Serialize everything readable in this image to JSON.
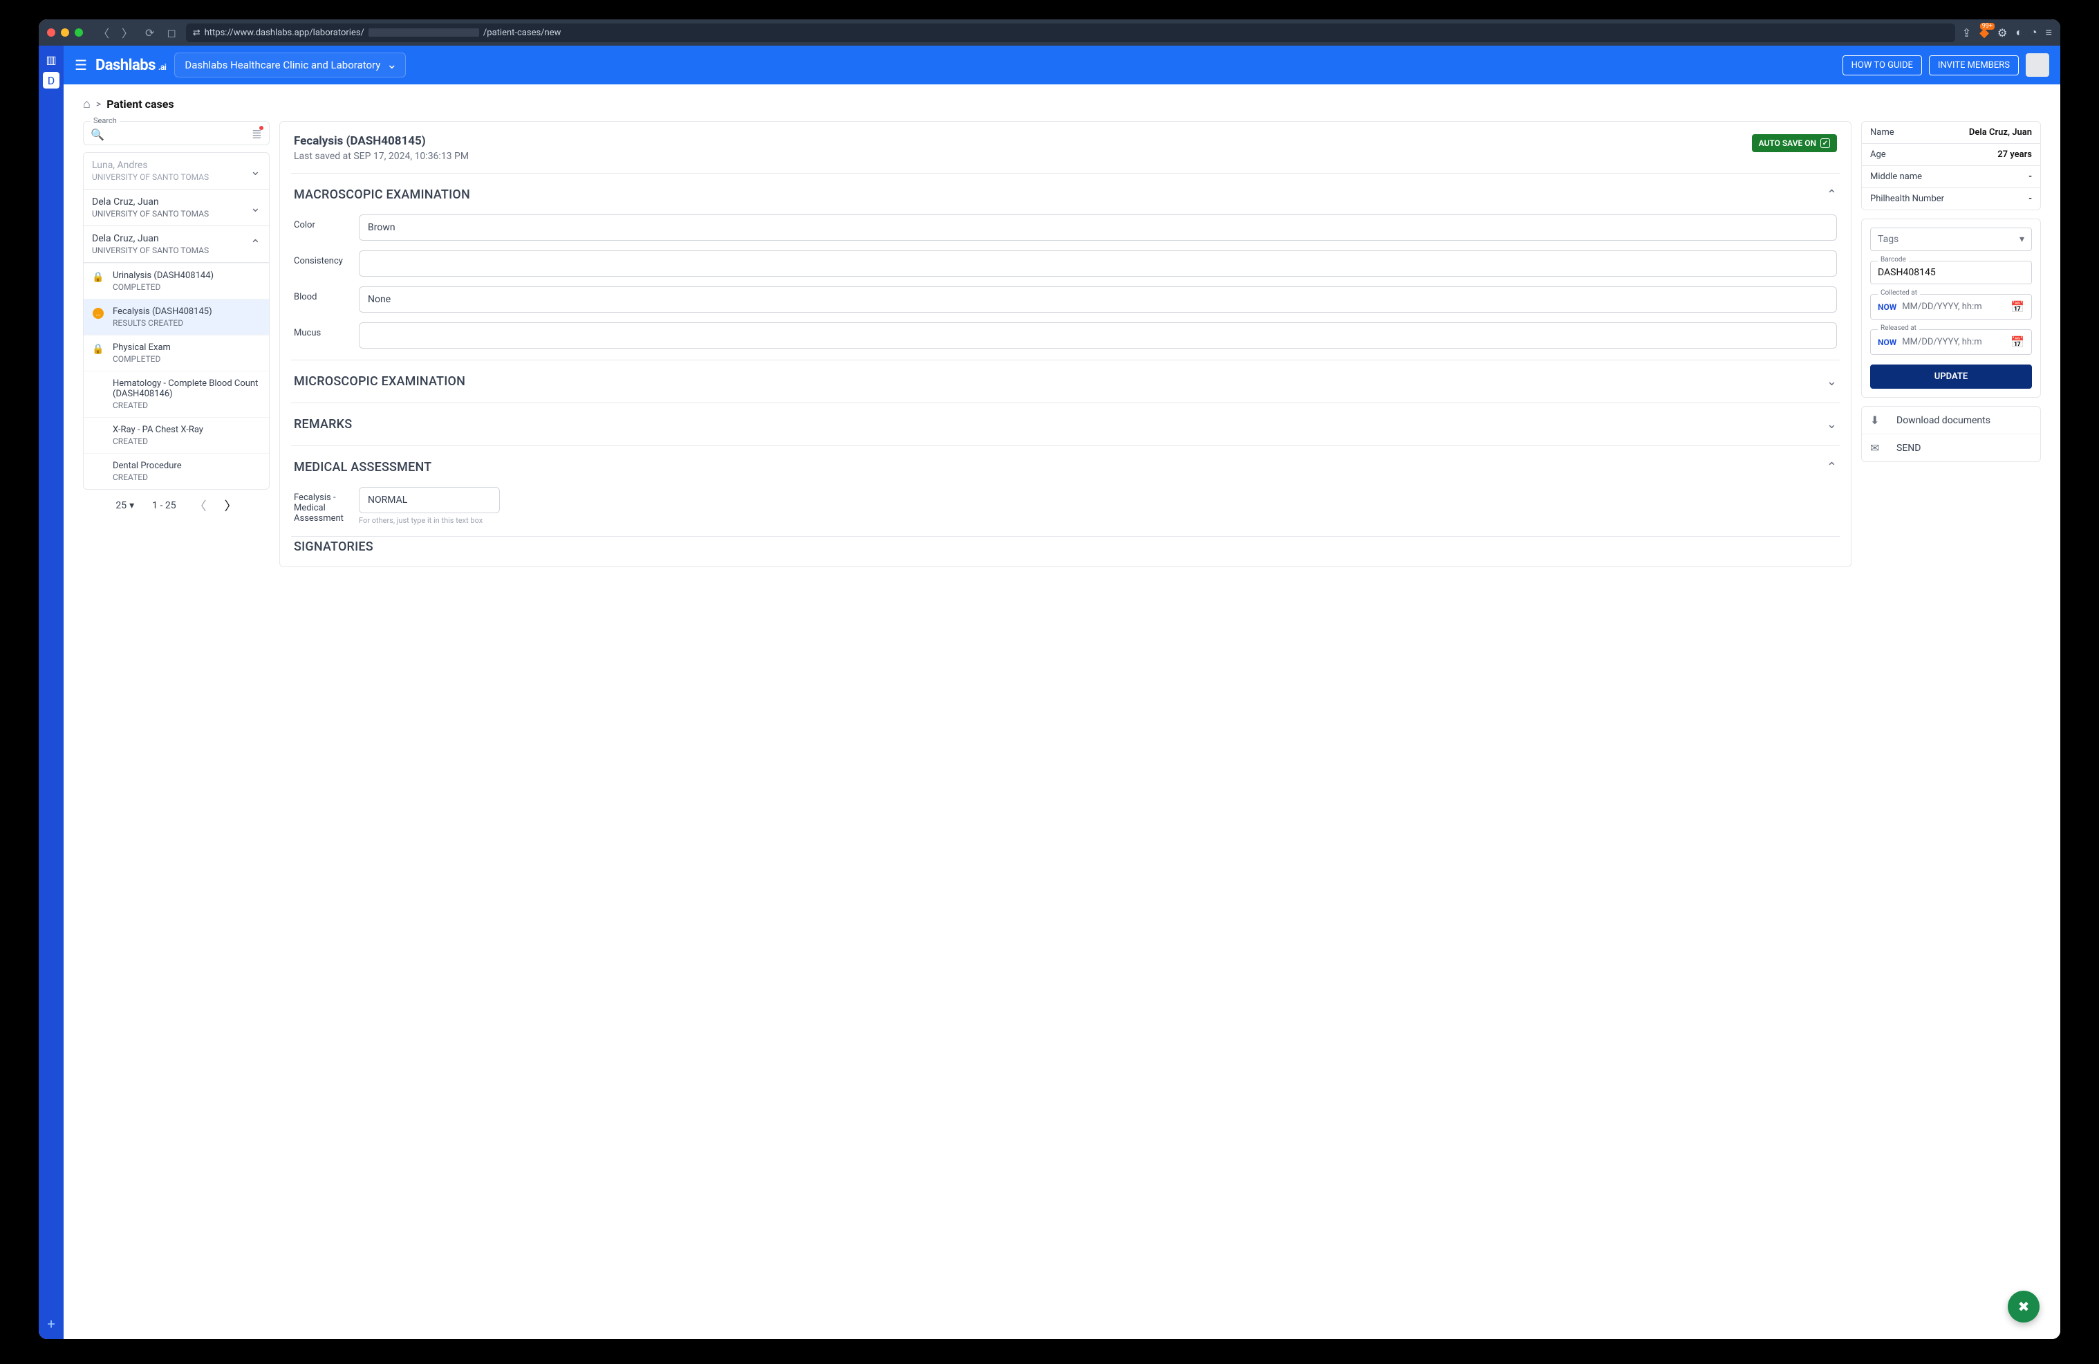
{
  "browser": {
    "url_prefix": "https://www.dashlabs.app/laboratories/",
    "url_suffix": "/patient-cases/new",
    "brave_badge": "99+"
  },
  "header": {
    "brand": "Dashlabs",
    "brand_suffix": ".ai",
    "org": "Dashlabs Healthcare Clinic and Laboratory",
    "how_to": "HOW TO GUIDE",
    "invite": "INVITE MEMBERS"
  },
  "breadcrumb": {
    "current": "Patient cases"
  },
  "search": {
    "label": "Search"
  },
  "cases": [
    {
      "name": "Luna, Andres",
      "org": "UNIVERSITY OF SANTO TOMAS",
      "muted": true,
      "expanded": false
    },
    {
      "name": "Dela Cruz, Juan",
      "org": "UNIVERSITY OF SANTO TOMAS",
      "muted": false,
      "expanded": false
    },
    {
      "name": "Dela Cruz, Juan",
      "org": "UNIVERSITY OF SANTO TOMAS",
      "muted": false,
      "expanded": true,
      "tests": [
        {
          "icon": "lock",
          "name": "Urinalysis (DASH408144)",
          "status": "COMPLETED",
          "selected": false
        },
        {
          "icon": "dots",
          "name": "Fecalysis (DASH408145)",
          "status": "RESULTS CREATED",
          "selected": true
        },
        {
          "icon": "lock",
          "name": "Physical Exam",
          "status": "COMPLETED",
          "selected": false
        },
        {
          "icon": "",
          "name": "Hematology - Complete Blood Count (DASH408146)",
          "status": "CREATED",
          "selected": false
        },
        {
          "icon": "",
          "name": "X-Ray - PA Chest X-Ray",
          "status": "CREATED",
          "selected": false
        },
        {
          "icon": "",
          "name": "Dental Procedure",
          "status": "CREATED",
          "selected": false
        }
      ]
    }
  ],
  "pager": {
    "size": "25",
    "range": "1 - 25"
  },
  "middle": {
    "title": "Fecalysis (DASH408145)",
    "last_saved": "Last saved at SEP 17, 2024, 10:36:13 PM",
    "autosave": "AUTO SAVE ON",
    "sections": {
      "macro": {
        "title": "MACROSCOPIC EXAMINATION",
        "open": true,
        "fields": {
          "color": {
            "label": "Color",
            "value": "Brown"
          },
          "consistency": {
            "label": "Consistency",
            "value": ""
          },
          "blood": {
            "label": "Blood",
            "value": "None"
          },
          "mucus": {
            "label": "Mucus",
            "value": ""
          }
        }
      },
      "micro": {
        "title": "MICROSCOPIC EXAMINATION",
        "open": false
      },
      "remarks": {
        "title": "REMARKS",
        "open": false
      },
      "assess": {
        "title": "MEDICAL ASSESSMENT",
        "open": true,
        "field_label": "Fecalysis - Medical Assessment",
        "field_value": "NORMAL",
        "help": "For others, just type it in this text box"
      },
      "sign": {
        "title": "SIGNATORIES",
        "open": false
      }
    }
  },
  "right": {
    "info": [
      {
        "k": "Name",
        "v": "Dela Cruz, Juan"
      },
      {
        "k": "Age",
        "v": "27 years"
      },
      {
        "k": "Middle name",
        "v": "-"
      },
      {
        "k": "Philhealth Number",
        "v": "-"
      }
    ],
    "tags": "Tags",
    "barcode": {
      "label": "Barcode",
      "value": "DASH408145"
    },
    "collected": {
      "label": "Collected at",
      "now": "NOW",
      "placeholder": "MM/DD/YYYY, hh:m"
    },
    "released": {
      "label": "Released at",
      "now": "NOW",
      "placeholder": "MM/DD/YYYY, hh:m"
    },
    "update": "UPDATE",
    "download": "Download documents",
    "send": "SEND"
  }
}
